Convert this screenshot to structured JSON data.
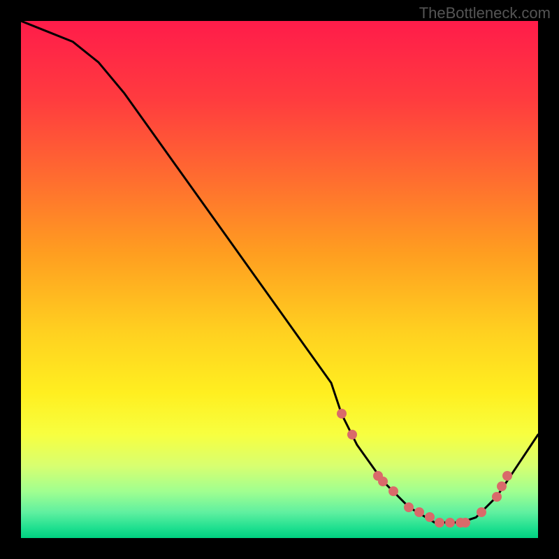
{
  "watermark": "TheBottleneck.com",
  "chart_data": {
    "type": "line",
    "title": "",
    "xlabel": "",
    "ylabel": "",
    "xlim": [
      0,
      100
    ],
    "ylim": [
      0,
      100
    ],
    "series": [
      {
        "name": "bottleneck-curve",
        "x": [
          0,
          5,
          10,
          15,
          20,
          25,
          30,
          35,
          40,
          45,
          50,
          55,
          60,
          62,
          65,
          70,
          75,
          80,
          85,
          88,
          92,
          96,
          100
        ],
        "values": [
          100,
          98,
          96,
          92,
          86,
          79,
          72,
          65,
          58,
          51,
          44,
          37,
          30,
          24,
          18,
          11,
          6,
          3,
          3,
          4,
          8,
          14,
          20
        ]
      }
    ],
    "markers": [
      {
        "x": 62,
        "y": 24
      },
      {
        "x": 64,
        "y": 20
      },
      {
        "x": 69,
        "y": 12
      },
      {
        "x": 70,
        "y": 11
      },
      {
        "x": 72,
        "y": 9
      },
      {
        "x": 75,
        "y": 6
      },
      {
        "x": 77,
        "y": 5
      },
      {
        "x": 79,
        "y": 4
      },
      {
        "x": 81,
        "y": 3
      },
      {
        "x": 83,
        "y": 3
      },
      {
        "x": 85,
        "y": 3
      },
      {
        "x": 86,
        "y": 3
      },
      {
        "x": 89,
        "y": 5
      },
      {
        "x": 92,
        "y": 8
      },
      {
        "x": 93,
        "y": 10
      },
      {
        "x": 94,
        "y": 12
      }
    ],
    "gradient_stops": [
      {
        "offset": 0.0,
        "color": "#ff1c4a"
      },
      {
        "offset": 0.15,
        "color": "#ff3b3f"
      },
      {
        "offset": 0.3,
        "color": "#ff6b30"
      },
      {
        "offset": 0.45,
        "color": "#ff9e20"
      },
      {
        "offset": 0.6,
        "color": "#ffd020"
      },
      {
        "offset": 0.72,
        "color": "#ffef20"
      },
      {
        "offset": 0.8,
        "color": "#f7ff40"
      },
      {
        "offset": 0.86,
        "color": "#d8ff70"
      },
      {
        "offset": 0.91,
        "color": "#a0ff90"
      },
      {
        "offset": 0.95,
        "color": "#60f0a0"
      },
      {
        "offset": 0.98,
        "color": "#20e090"
      },
      {
        "offset": 1.0,
        "color": "#00d080"
      }
    ]
  }
}
